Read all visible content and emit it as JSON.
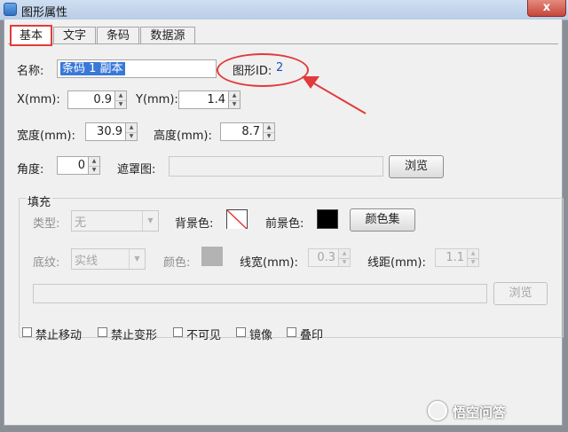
{
  "window": {
    "title": "图形属性",
    "close_label": "x"
  },
  "tabs": [
    "基本",
    "文字",
    "条码",
    "数据源"
  ],
  "basic": {
    "name_label": "名称:",
    "name_value": "条码 1 副本",
    "shape_id_label": "图形ID:",
    "shape_id_value": "2",
    "x_label": "X(mm):",
    "x_value": "0.9",
    "y_label": "Y(mm):",
    "y_value": "1.4",
    "width_label": "宽度(mm):",
    "width_value": "30.9",
    "height_label": "高度(mm):",
    "height_value": "8.7",
    "angle_label": "角度:",
    "angle_value": "0",
    "mask_label": "遮罩图:",
    "mask_value": "",
    "browse_label": "浏览"
  },
  "fill": {
    "group_title": "填充",
    "type_label": "类型:",
    "type_value": "无",
    "bg_color_label": "背景色:",
    "fg_color_label": "前景色:",
    "color_set_label": "颜色集",
    "texture_label": "底纹:",
    "texture_value": "实线",
    "color_label": "颜色:",
    "line_width_label": "线宽(mm):",
    "line_width_value": "0.3",
    "line_spacing_label": "线距(mm):",
    "line_spacing_value": "1.1",
    "image_path_value": "",
    "browse_label": "浏览"
  },
  "checkboxes": [
    "禁止移动",
    "禁止变形",
    "不可见",
    "镜像",
    "叠印"
  ],
  "watermark": "悟空问答",
  "colors": {
    "annotation_red": "#e23b3b",
    "fg_black": "#000000",
    "disabled_gray": "#b3b3b3",
    "selection_blue": "#3a78d8"
  }
}
